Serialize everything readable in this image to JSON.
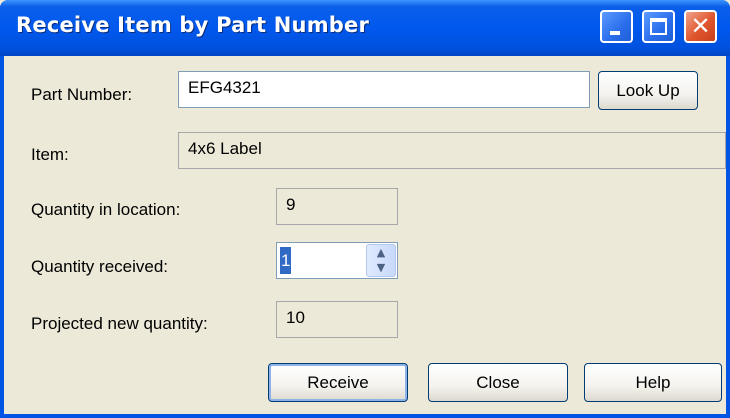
{
  "window": {
    "title": "Receive Item by Part Number",
    "minimize_glyph": "",
    "close_glyph": "✕"
  },
  "form": {
    "part_number": {
      "label": "Part Number:",
      "value": "EFG4321"
    },
    "lookup_button": "Look Up",
    "item": {
      "label": "Item:",
      "value": "4x6 Label"
    },
    "quantity_in_location": {
      "label": "Quantity in location:",
      "value": "9"
    },
    "quantity_received": {
      "label": "Quantity received:",
      "value": "1",
      "up_glyph": "▲",
      "down_glyph": "▼"
    },
    "projected_new_quantity": {
      "label": "Projected new quantity:",
      "value": "10"
    }
  },
  "buttons": {
    "receive": "Receive",
    "close": "Close",
    "help": "Help"
  }
}
